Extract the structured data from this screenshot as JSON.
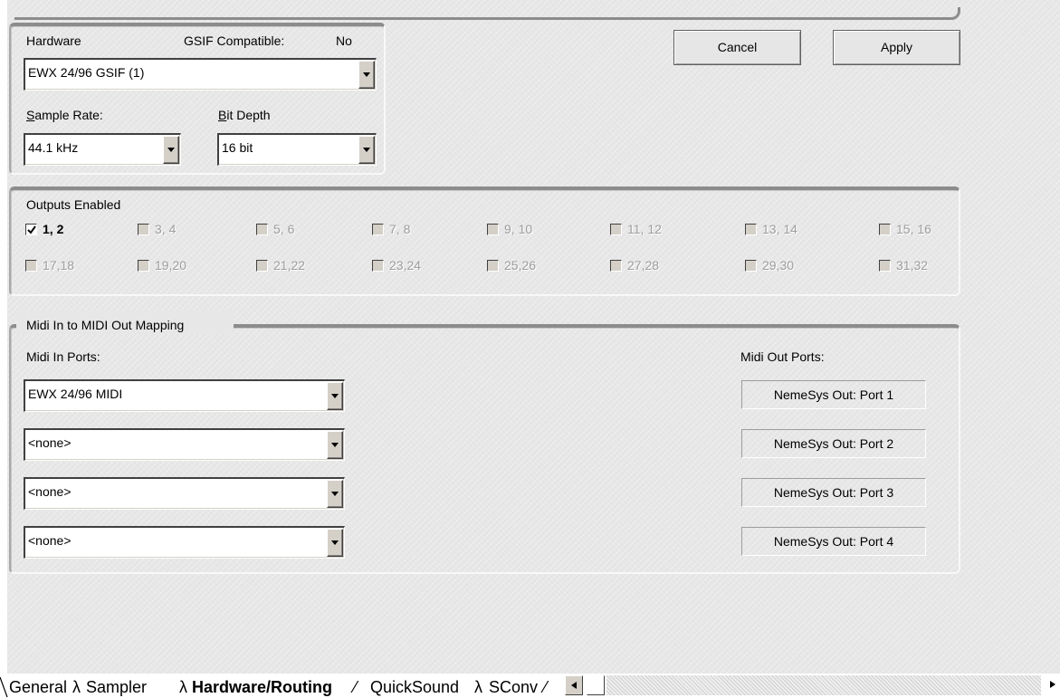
{
  "hardware": {
    "label": "Hardware",
    "gsif_label": "GSIF Compatible:",
    "gsif_value": "No",
    "device": "EWX 24/96 GSIF (1)",
    "sample_rate_label_key": "S",
    "sample_rate_label_rest": "ample Rate:",
    "sample_rate": "44.1 kHz",
    "bit_depth_label_key": "B",
    "bit_depth_label_rest": "it Depth",
    "bit_depth": "16 bit"
  },
  "buttons": {
    "cancel": "Cancel",
    "apply": "Apply"
  },
  "outputs": {
    "title": "Outputs Enabled",
    "items": [
      {
        "label": "1, 2",
        "checked": true,
        "enabled": true
      },
      {
        "label": "3, 4",
        "checked": false,
        "enabled": false
      },
      {
        "label": "5, 6",
        "checked": false,
        "enabled": false
      },
      {
        "label": "7, 8",
        "checked": false,
        "enabled": false
      },
      {
        "label": "9, 10",
        "checked": false,
        "enabled": false
      },
      {
        "label": "11, 12",
        "checked": false,
        "enabled": false
      },
      {
        "label": "13, 14",
        "checked": false,
        "enabled": false
      },
      {
        "label": "15, 16",
        "checked": false,
        "enabled": false
      },
      {
        "label": "17,18",
        "checked": false,
        "enabled": false
      },
      {
        "label": "19,20",
        "checked": false,
        "enabled": false
      },
      {
        "label": "21,22",
        "checked": false,
        "enabled": false
      },
      {
        "label": "23,24",
        "checked": false,
        "enabled": false
      },
      {
        "label": "25,26",
        "checked": false,
        "enabled": false
      },
      {
        "label": "27,28",
        "checked": false,
        "enabled": false
      },
      {
        "label": "29,30",
        "checked": false,
        "enabled": false
      },
      {
        "label": "31,32",
        "checked": false,
        "enabled": false
      }
    ]
  },
  "midi": {
    "title": "Midi In to MIDI Out Mapping",
    "in_label": "Midi In Ports:",
    "out_label": "Midi Out Ports:",
    "in_ports": [
      "EWX 24/96 MIDI",
      "<none>",
      "<none>",
      "<none>"
    ],
    "out_ports": [
      "NemeSys Out: Port 1",
      "NemeSys Out: Port 2",
      "NemeSys Out: Port 3",
      "NemeSys Out: Port 4"
    ]
  },
  "tabs": [
    {
      "label": "General",
      "active": false
    },
    {
      "label": "Sampler",
      "active": false
    },
    {
      "label": "Hardware/Routing",
      "active": true
    },
    {
      "label": "QuickSound",
      "active": false
    },
    {
      "label": "SConv",
      "active": false
    }
  ]
}
